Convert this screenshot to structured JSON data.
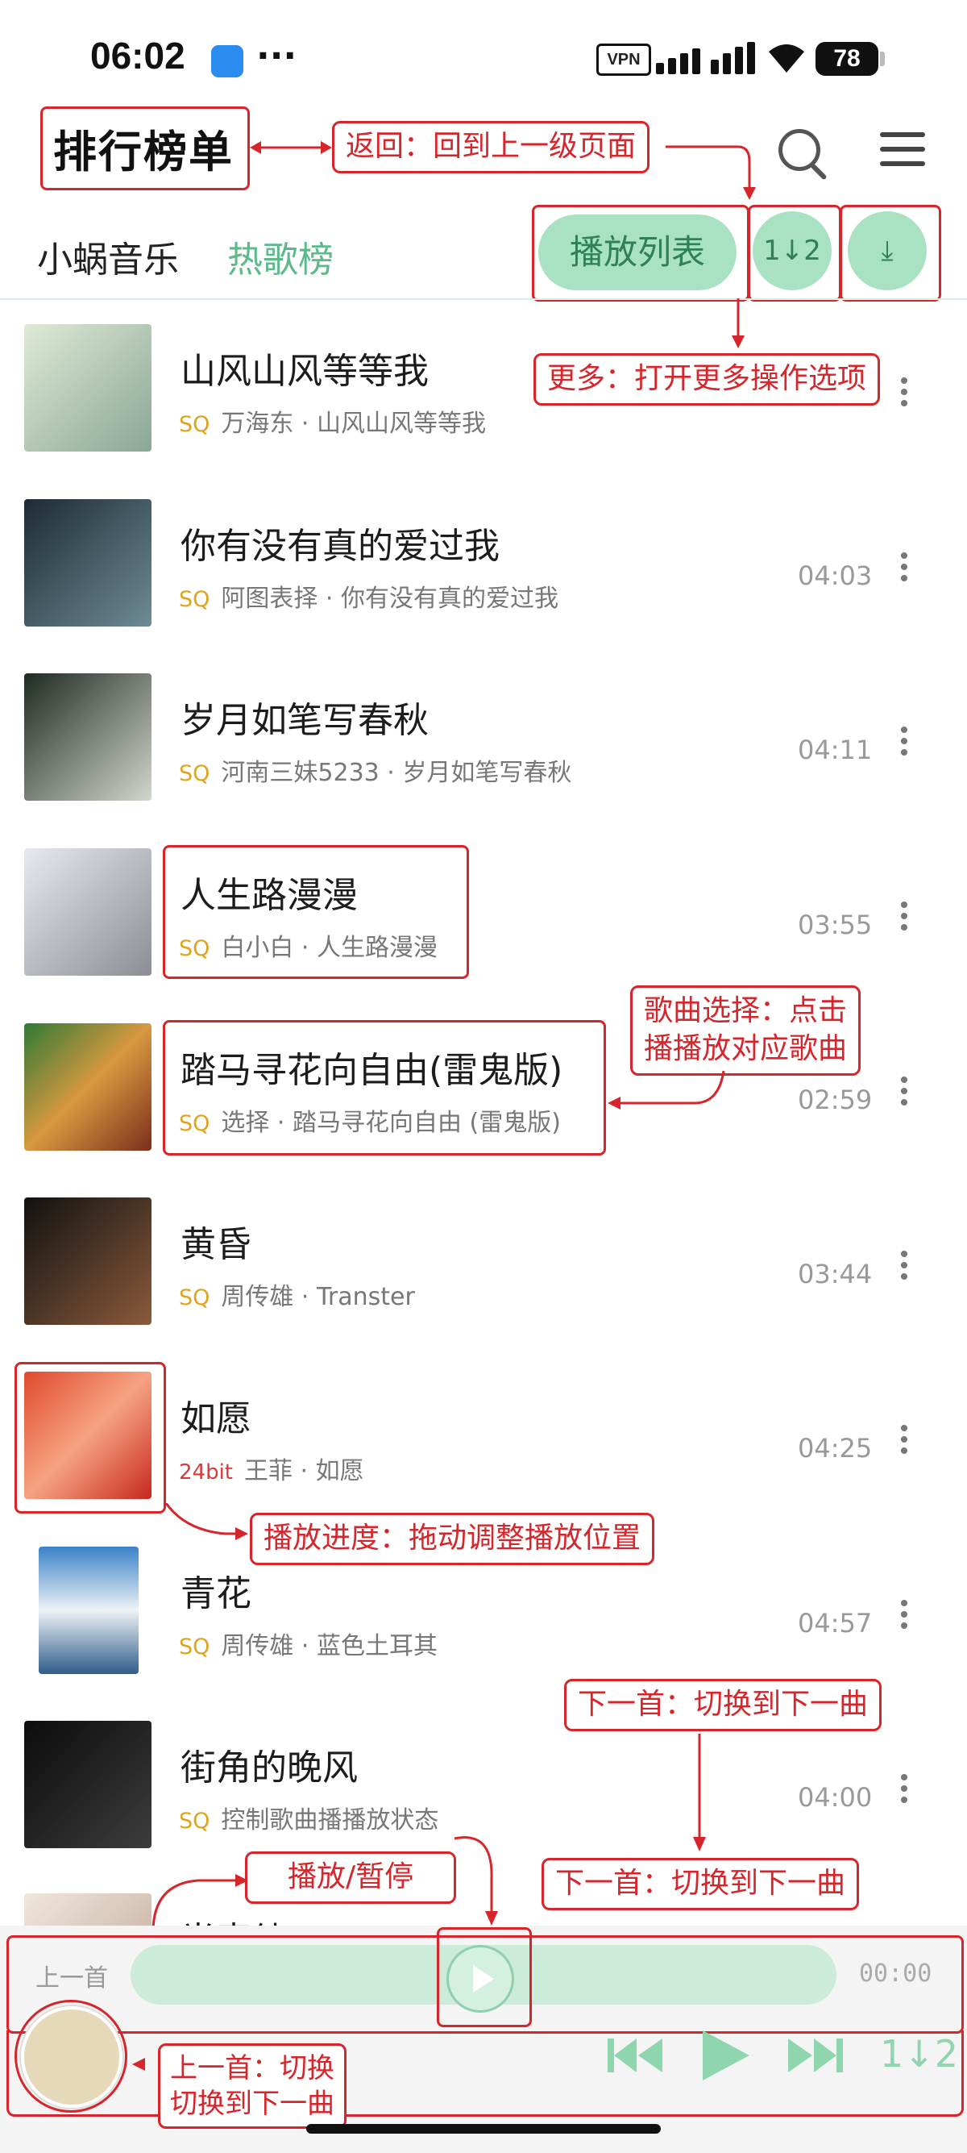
{
  "status_bar": {
    "time": "06:02",
    "dots": "···",
    "vpn": "VPN",
    "battery": "78"
  },
  "header": {
    "title": "排行榜单"
  },
  "tabs": {
    "source": "小蜗音乐",
    "chart": "热歌榜",
    "play_list_button": "播放列表"
  },
  "icons": {
    "sort": "1↓2",
    "download": "⤓",
    "search": "search-icon",
    "menu": "menu-icon"
  },
  "songs": [
    {
      "title": "山风山风等等我",
      "quality": "SQ",
      "subtitle": "万海东 · 山风山风等等我",
      "duration": ""
    },
    {
      "title": "你有没有真的爱过我",
      "quality": "SQ",
      "subtitle": "阿图表择 · 你有没有真的爱过我",
      "duration": "04:03"
    },
    {
      "title": "岁月如笔写春秋",
      "quality": "SQ",
      "subtitle": "河南三妹5233 · 岁月如笔写春秋",
      "duration": "04:11"
    },
    {
      "title": "人生路漫漫",
      "quality": "SQ",
      "subtitle": "白小白 · 人生路漫漫",
      "duration": "03:55"
    },
    {
      "title": "踏马寻花向自由(雷鬼版)",
      "quality": "SQ",
      "subtitle": "选择 · 踏马寻花向自由 (雷鬼版)",
      "duration": "02:59"
    },
    {
      "title": "黄昏",
      "quality": "SQ",
      "subtitle": "周传雄 · Transter",
      "duration": "03:44"
    },
    {
      "title": "如愿",
      "quality": "24bit",
      "subtitle": "王菲 · 如愿",
      "duration": "04:25"
    },
    {
      "title": "青花",
      "quality": "SQ",
      "subtitle": "周传雄 · 蓝色土耳其",
      "duration": "04:57"
    },
    {
      "title": "街角的晚风",
      "quality": "SQ",
      "subtitle": "控制歌曲播播放状态",
      "duration": "04:00"
    },
    {
      "title": "半壶纱",
      "quality": "",
      "subtitle": "",
      "duration": ""
    }
  ],
  "player": {
    "prev_label": "上一首",
    "time_end": "00:00"
  },
  "annotations": {
    "back": "返回：回到上一级页面",
    "more": "更多：打开更多操作选项",
    "song_select_1": "歌曲选择：点击",
    "song_select_2": "播播放对应歌曲",
    "progress": "播放进度：拖动调整播放位置",
    "next_1": "下一首：切换到下一曲",
    "next_2": "下一首：切换到下一曲",
    "play_pause": "播放/暂停",
    "prev_1": "上一首：切换",
    "prev_2": "切换到下一曲"
  },
  "colors": {
    "accent": "#a9e2c2",
    "accent_text": "#5cb98a",
    "annotation": "#d6262b",
    "quality_sq": "#e0a31c",
    "quality_24bit": "#d83a3a"
  }
}
